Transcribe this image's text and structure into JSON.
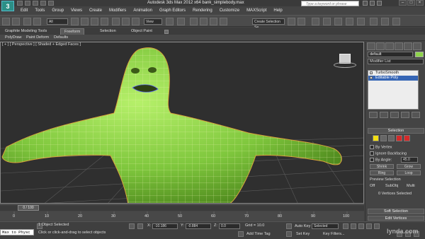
{
  "app": {
    "title": "Autodesk 3ds Max  2012 x64    bank_simplebody.max",
    "logo_letter": "3",
    "search_placeholder": "Type a keyword or phrase"
  },
  "menu": [
    "Edit",
    "Tools",
    "Group",
    "Views",
    "Create",
    "Modifiers",
    "Animation",
    "Graph Editors",
    "Rendering",
    "Customize",
    "MAXScript",
    "Help"
  ],
  "toolbar": {
    "filter_select": "All",
    "view_select": "View",
    "selection_set": "Create Selection Se"
  },
  "ribbon": {
    "tabs": [
      "Graphite Modeling Tools",
      "Freeform",
      "Selection",
      "Object Paint"
    ],
    "active_tab": "Freeform",
    "subtabs": [
      "PolyDraw",
      "Paint Deform",
      "Defaults"
    ]
  },
  "viewport": {
    "label": "[ + ] [ Perspective ] [ Shaded + Edged Faces ]",
    "accent_color": "#8ed44a"
  },
  "command_panel": {
    "object_name": "default",
    "modifier_list": "Modifier List",
    "stack": [
      "TurboSmooth",
      "Editable Poly"
    ],
    "selected_stack_item": "Editable Poly",
    "selection_rollout": "Selection",
    "by_vertex": "By Vertex",
    "ignore_backfacing": "Ignore Backfacing",
    "by_angle": "By Angle:",
    "angle_value": "45.0",
    "shrink": "Shrink",
    "grow": "Grow",
    "ring": "Ring",
    "loop": "Loop",
    "preview_selection": "Preview Selection",
    "preview_options": [
      "Off",
      "SubObj",
      "Multi"
    ],
    "vertices_selected": "0 Vertices Selected",
    "soft_selection": "Soft Selection",
    "edit_vertices": "Edit Vertices"
  },
  "timeline": {
    "frame_display": "0 / 100",
    "ticks": [
      "0",
      "10",
      "20",
      "30",
      "40",
      "50",
      "60",
      "70",
      "80",
      "90",
      "100"
    ]
  },
  "status": {
    "maxscript": "Max to Physc",
    "object_selected": "1 Object Selected",
    "prompt": "Click or click-and-drag to select objects",
    "x_label": "X:",
    "x_value": "-10.186",
    "y_label": "Y:",
    "y_value": "-0.884",
    "z_label": "Z:",
    "z_value": "0.0",
    "grid": "Grid = 10.0",
    "add_time_tag": "Add Time Tag",
    "auto_key": "Auto Key",
    "selected": "Selected",
    "set_key": "Set Key",
    "key_filters": "Key Filters..."
  },
  "watermark": "lynda.com"
}
